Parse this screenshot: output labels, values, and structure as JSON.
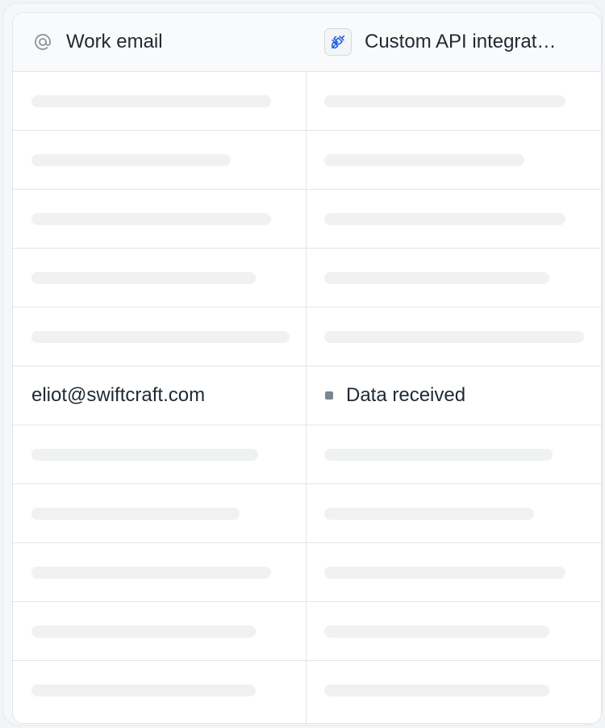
{
  "columns": [
    {
      "label": "Work email",
      "icon": "at-icon"
    },
    {
      "label": "Custom API integrat…",
      "icon": "plug-icon"
    }
  ],
  "loaded_row": {
    "email": "eliot@swiftcraft.com",
    "status": "Data received",
    "status_color": "#7a8690"
  },
  "colors": {
    "skeleton": "#f0f1f3",
    "border": "#e3e5e8",
    "header_bg": "#f9fafb",
    "icon_blue": "#2563eb"
  },
  "rows": [
    {
      "state": "loading",
      "skeleton_fill": [
        0.77,
        0.77
      ]
    },
    {
      "state": "loading",
      "skeleton_fill": [
        0.64,
        0.64
      ]
    },
    {
      "state": "loading",
      "skeleton_fill": [
        0.77,
        0.77
      ]
    },
    {
      "state": "loading",
      "skeleton_fill": [
        0.72,
        0.72
      ]
    },
    {
      "state": "loading",
      "skeleton_fill": [
        0.83,
        0.83
      ]
    },
    {
      "state": "loaded"
    },
    {
      "state": "loading",
      "skeleton_fill": [
        0.73,
        0.73
      ]
    },
    {
      "state": "loading",
      "skeleton_fill": [
        0.67,
        0.67
      ]
    },
    {
      "state": "loading",
      "skeleton_fill": [
        0.77,
        0.77
      ]
    },
    {
      "state": "loading",
      "skeleton_fill": [
        0.72,
        0.72
      ]
    },
    {
      "state": "loading",
      "skeleton_fill": [
        0.72,
        0.72
      ]
    }
  ]
}
